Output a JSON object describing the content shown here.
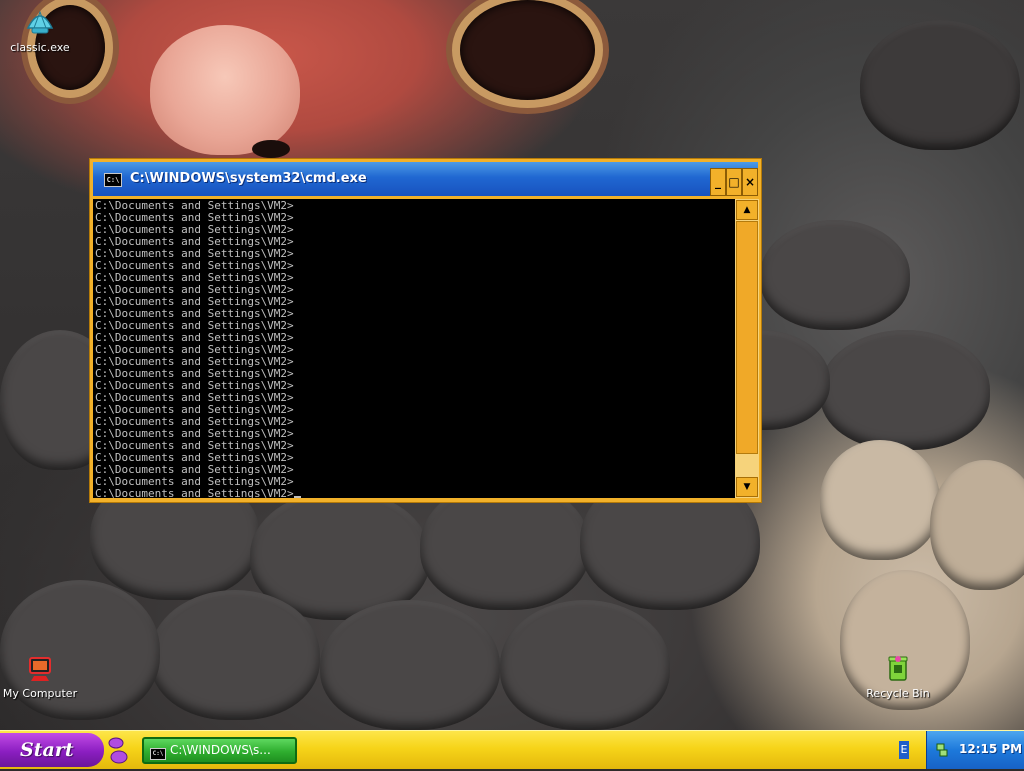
{
  "desktop": {
    "icons": [
      {
        "label": "classic.exe"
      },
      {
        "label": "My Computer"
      },
      {
        "label": "Recycle Bin"
      }
    ]
  },
  "window": {
    "title": "C:\\WINDOWS\\system32\\cmd.exe",
    "icon_text": "C:\\",
    "minimize": "_",
    "maximize": "□",
    "close": "×",
    "prompt_line": "C:\\Documents and Settings\\VM2>",
    "line_count": 25,
    "scroll_up": "▲",
    "scroll_down": "▼"
  },
  "taskbar": {
    "start_label": "Start",
    "task_title": "C:\\WINDOWS\\s...",
    "language": "E",
    "clock": "12:15 PM"
  },
  "colors": {
    "titlebar": "#2067d1",
    "window_frame": "#f2b12a",
    "taskbar": "#f6d419",
    "start_button": "#8b1ec1",
    "task_button": "#2fae2f",
    "tray": "#1d79db"
  },
  "icons": {
    "classic_exe": "shell-icon",
    "my_computer": "computer-icon",
    "recycle_bin": "recycle-bin-icon",
    "network": "network-icon"
  }
}
